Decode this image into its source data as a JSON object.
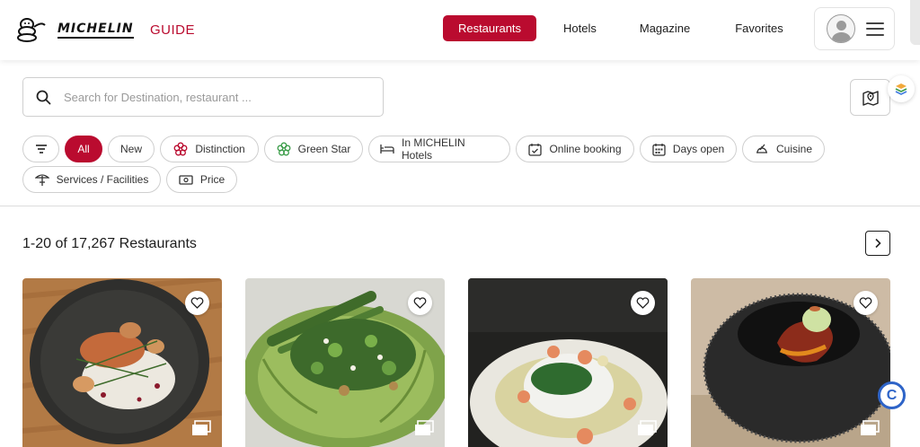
{
  "header": {
    "brand_word": "MICHELIN",
    "brand_guide": "GUIDE",
    "nav": [
      {
        "label": "Restaurants",
        "active": true
      },
      {
        "label": "Hotels",
        "active": false
      },
      {
        "label": "Magazine",
        "active": false
      },
      {
        "label": "Favorites",
        "active": false
      }
    ]
  },
  "search": {
    "placeholder": "Search for Destination, restaurant ..."
  },
  "filters": {
    "items": [
      {
        "label": "All",
        "icon": "none",
        "active": true
      },
      {
        "label": "New",
        "icon": "none"
      },
      {
        "label": "Distinction",
        "icon": "michelin-flower-icon"
      },
      {
        "label": "Green Star",
        "icon": "green-star-icon"
      },
      {
        "label": "In MICHELIN Hotels",
        "icon": "bed-icon"
      },
      {
        "label": "Online booking",
        "icon": "calendar-check-icon"
      },
      {
        "label": "Days open",
        "icon": "calendar-grid-icon"
      },
      {
        "label": "Cuisine",
        "icon": "dish-icon"
      },
      {
        "label": "Services / Facilities",
        "icon": "parasol-icon"
      },
      {
        "label": "Price",
        "icon": "banknote-icon"
      }
    ]
  },
  "results": {
    "count_text": "1-20 of 17,267 Restaurants"
  },
  "colors": {
    "brand_red": "#ba0b2f",
    "green_star": "#3c9d4a",
    "badge_blue": "#2e64c8"
  },
  "badge": {
    "letter": "C"
  }
}
